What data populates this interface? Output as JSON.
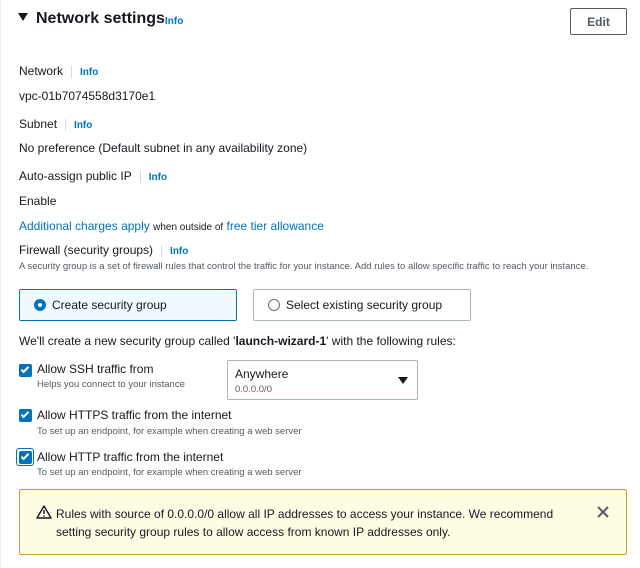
{
  "section": {
    "title": "Network settings",
    "info": "Info",
    "edit_label": "Edit"
  },
  "network": {
    "label": "Network",
    "info": "Info",
    "value": "vpc-01b7074558d3170e1"
  },
  "subnet": {
    "label": "Subnet",
    "info": "Info",
    "value": "No preference (Default subnet in any availability zone)"
  },
  "public_ip": {
    "label": "Auto-assign public IP",
    "info": "Info",
    "value": "Enable"
  },
  "charges": {
    "link1": "Additional charges apply",
    "middle": "when outside of",
    "link2": "free tier allowance"
  },
  "firewall": {
    "label": "Firewall (security groups)",
    "info": "Info",
    "description": "A security group is a set of firewall rules that control the traffic for your instance. Add rules to allow specific traffic to reach your instance.",
    "options": [
      {
        "label": "Create security group",
        "selected": true
      },
      {
        "label": "Select existing security group",
        "selected": false
      }
    ],
    "note_prefix": "We'll create a new security group called '",
    "group_name": "launch-wizard-1",
    "note_suffix": "' with the following rules:"
  },
  "rules": [
    {
      "label": "Allow SSH traffic from",
      "description": "Helps you connect to your instance",
      "checked": true
    },
    {
      "label": "Allow HTTPS traffic from the internet",
      "description": "To set up an endpoint, for example when creating a web server",
      "checked": true
    },
    {
      "label": "Allow HTTP traffic from the internet",
      "description": "To set up an endpoint, for example when creating a web server",
      "checked": true
    }
  ],
  "ssh_source": {
    "value": "Anywhere",
    "sub": "0.0.0.0/0"
  },
  "alert": {
    "text": "Rules with source of 0.0.0.0/0 allow all IP addresses to access your instance. We recommend setting security group rules to allow access from known IP addresses only.",
    "icon": "warning-icon",
    "close_icon": "close-icon"
  },
  "colors": {
    "accent": "#0073bb",
    "warning_bg": "#fffce4",
    "warning_border": "#c9a02c"
  }
}
